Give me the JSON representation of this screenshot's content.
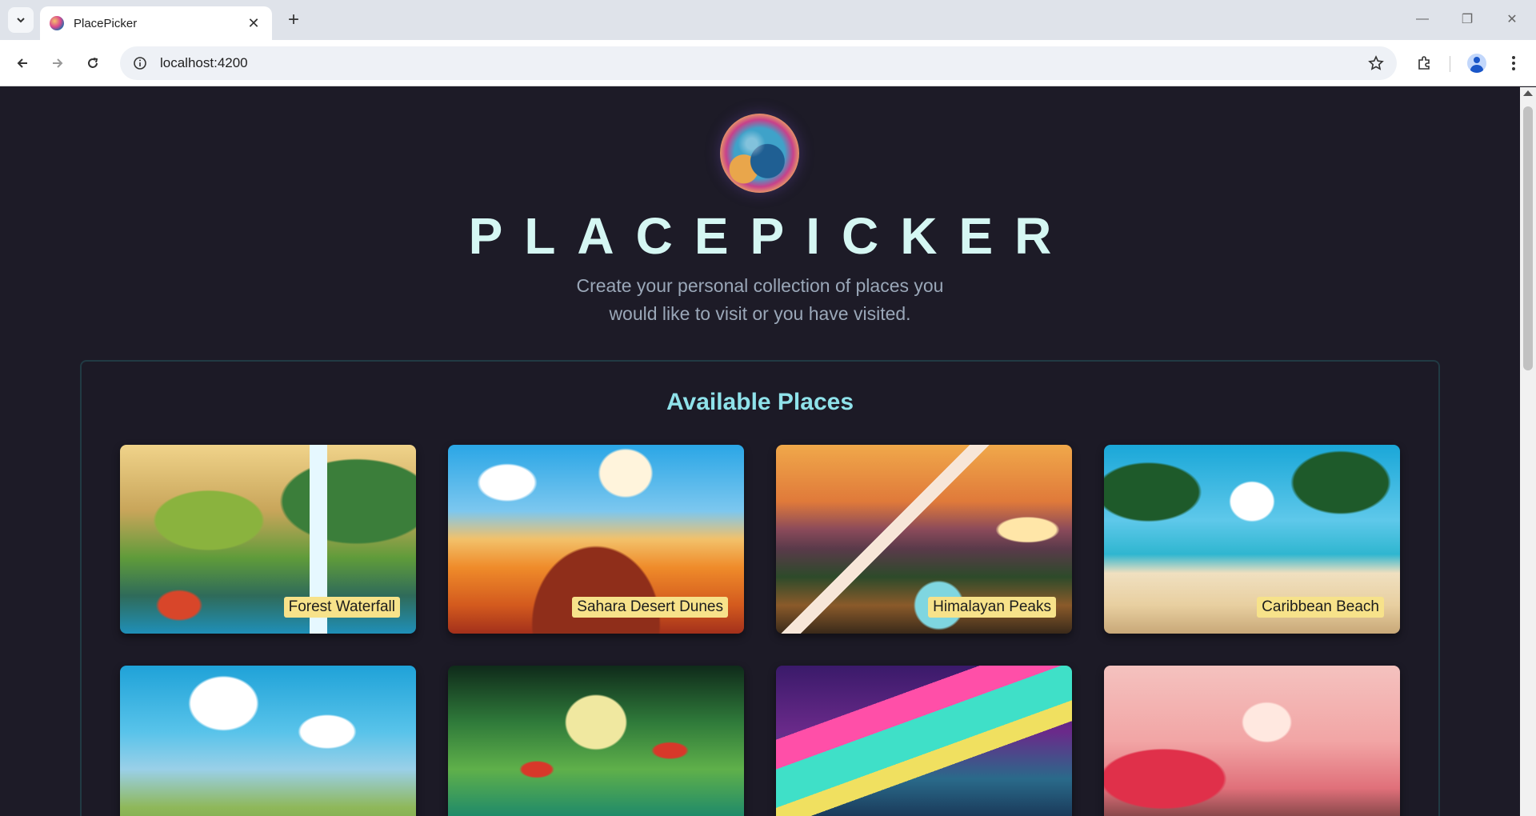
{
  "browser": {
    "tab_title": "PlacePicker",
    "url": "localhost:4200"
  },
  "page": {
    "title": "PLACEPICKER",
    "subtitle": "Create your personal collection of places you would like to visit or you have visited.",
    "logo_icon": "globe-logo"
  },
  "available_places": {
    "heading": "Available Places",
    "places": [
      {
        "label": "Forest Waterfall"
      },
      {
        "label": "Sahara Desert Dunes"
      },
      {
        "label": "Himalayan Peaks"
      },
      {
        "label": "Caribbean Beach"
      },
      {
        "label": ""
      },
      {
        "label": ""
      },
      {
        "label": ""
      },
      {
        "label": ""
      }
    ]
  },
  "colors": {
    "background": "#1d1b27",
    "title": "#d5f7f3",
    "heading": "#8fe2ea",
    "label_bg": "#f7e28a"
  }
}
